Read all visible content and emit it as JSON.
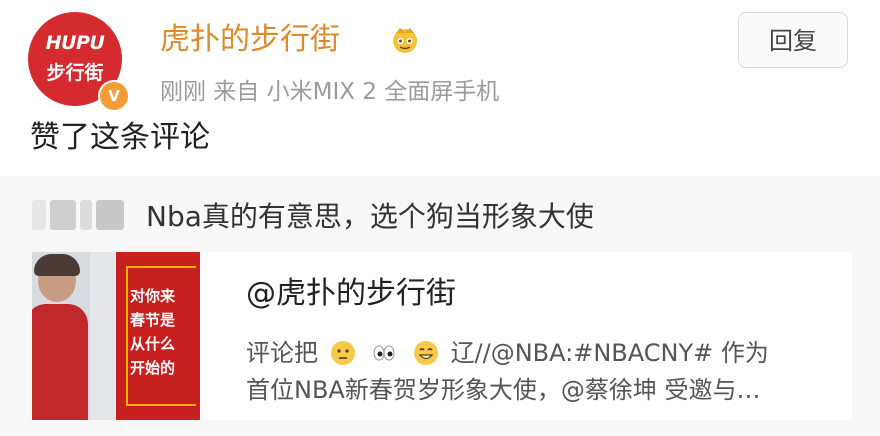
{
  "header": {
    "avatar_line1": "HUPU",
    "avatar_line2": "步行街",
    "verified_mark": "V",
    "username": "虎扑的步行街",
    "crown_icon": "crown-icon",
    "meta": "刚刚  来自 小米MIX 2 全面屏手机",
    "reply_button": "回复",
    "action_text": "赞了这条评论"
  },
  "comment": {
    "text": "Nba真的有意思，选个狗当形象大使"
  },
  "card": {
    "thumbnail_lines": [
      "对你来",
      "春节是",
      "从什么",
      "开始的"
    ],
    "title": "@虎扑的步行街",
    "line1_prefix": "评论把",
    "line1_icons": [
      "face-emoji-icon",
      "eyes-emoji-icon",
      "grin-emoji-icon"
    ],
    "line1_suffix": "辽//@NBA:#NBACNY# 作为",
    "line2": "首位NBA新春贺岁形象大使，@蔡徐坤 受邀与…"
  },
  "colors": {
    "username": "#dd8a2a",
    "avatar": "#d52a2e",
    "verified": "#f29d38",
    "meta": "#9b9b9b",
    "background": "#f8f8f8"
  }
}
